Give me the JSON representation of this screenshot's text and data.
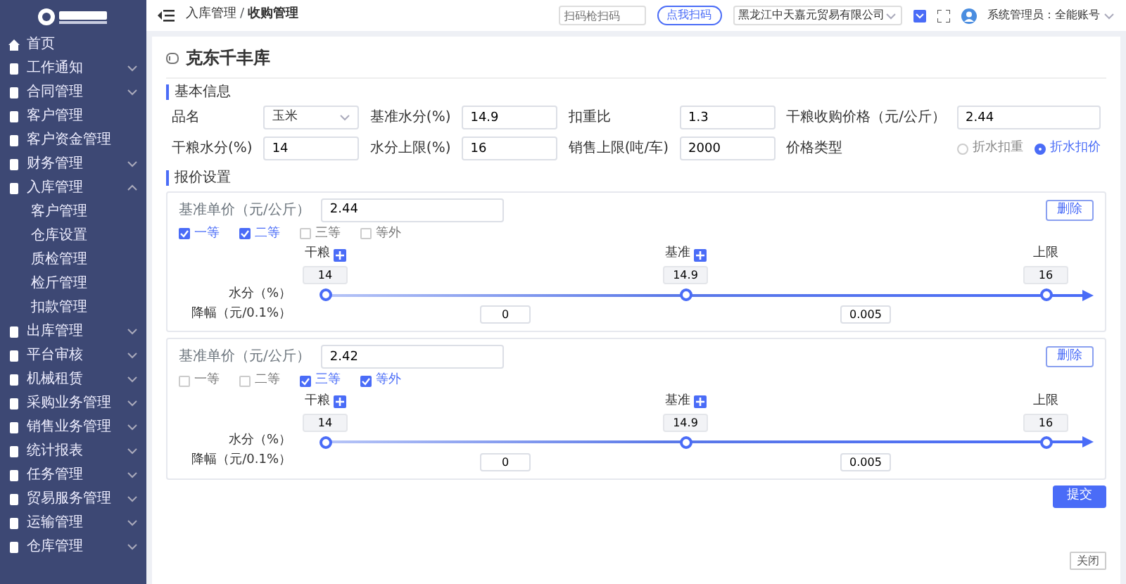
{
  "header": {
    "breadcrumb": [
      "入库管理",
      "收购管理"
    ],
    "breadcrumb_separator": "/",
    "search": {
      "placeholder": "扫码枪扫码"
    },
    "scan_button": "点我扫码",
    "company": "黑龙江中天嘉元贸易有限公司",
    "user": "系统管理员：全能账号"
  },
  "sidebar": {
    "items": [
      {
        "label": "首页",
        "kind": "link"
      },
      {
        "label": "工作通知",
        "kind": "group",
        "expanded": false
      },
      {
        "label": "合同管理",
        "kind": "group",
        "expanded": false
      },
      {
        "label": "客户管理",
        "kind": "link"
      },
      {
        "label": "客户资金管理",
        "kind": "link"
      },
      {
        "label": "财务管理",
        "kind": "group",
        "expanded": false
      },
      {
        "label": "入库管理",
        "kind": "group",
        "expanded": true,
        "children": [
          {
            "label": "客户管理"
          },
          {
            "label": "仓库设置"
          },
          {
            "label": "质检管理"
          },
          {
            "label": "检斤管理"
          },
          {
            "label": "扣款管理"
          }
        ]
      },
      {
        "label": "出库管理",
        "kind": "group",
        "expanded": false
      },
      {
        "label": "平台审核",
        "kind": "group",
        "expanded": false
      },
      {
        "label": "机械租赁",
        "kind": "group",
        "expanded": false
      },
      {
        "label": "采购业务管理",
        "kind": "group",
        "expanded": false
      },
      {
        "label": "销售业务管理",
        "kind": "group",
        "expanded": false
      },
      {
        "label": "统计报表",
        "kind": "group",
        "expanded": false
      },
      {
        "label": "任务管理",
        "kind": "group",
        "expanded": false
      },
      {
        "label": "贸易服务管理",
        "kind": "group",
        "expanded": false
      },
      {
        "label": "运输管理",
        "kind": "group",
        "expanded": false
      },
      {
        "label": "仓库管理",
        "kind": "group",
        "expanded": false
      }
    ]
  },
  "title": "克东千丰库",
  "basic_info": {
    "title": "基本信息",
    "fields": [
      {
        "label": "品名",
        "kind": "select",
        "value": "玉米"
      },
      {
        "label": "基准水分(%)",
        "kind": "text",
        "value": "14.9"
      },
      {
        "label": "扣重比",
        "kind": "text",
        "value": "1.3"
      },
      {
        "label": "干粮收购价格（元/公斤）",
        "kind": "text",
        "value": "2.44"
      },
      {
        "label": "干粮水分(%)",
        "kind": "text",
        "value": "14"
      },
      {
        "label": "水分上限(%)",
        "kind": "text",
        "value": "16"
      },
      {
        "label": "销售上限(吨/车)",
        "kind": "text",
        "value": "2000"
      },
      {
        "label": "价格类型",
        "kind": "radio",
        "options": [
          {
            "label": "折水扣重",
            "selected": false
          },
          {
            "label": "折水扣价",
            "selected": true
          }
        ]
      }
    ]
  },
  "price_settings": {
    "title": "报价设置",
    "blocks": [
      {
        "price_label": "基准单价（元/公斤）",
        "price": "2.44",
        "delete_button": "删除",
        "grades": [
          {
            "label": "一等",
            "checked": true
          },
          {
            "label": "二等",
            "checked": true
          },
          {
            "label": "三等",
            "checked": false
          },
          {
            "label": "等外",
            "checked": false
          }
        ],
        "nodes": [
          {
            "label": "干粮",
            "addable": true,
            "value": "14"
          },
          {
            "label": "基准",
            "addable": true,
            "value": "14.9"
          },
          {
            "label": "上限",
            "addable": false,
            "value": "16"
          }
        ],
        "axis_label": "水分（%）",
        "drop_label": "降幅（元/0.1%）",
        "drops": [
          "0",
          "0.005"
        ]
      },
      {
        "price_label": "基准单价（元/公斤）",
        "price": "2.42",
        "delete_button": "删除",
        "grades": [
          {
            "label": "一等",
            "checked": false
          },
          {
            "label": "二等",
            "checked": false
          },
          {
            "label": "三等",
            "checked": true
          },
          {
            "label": "等外",
            "checked": true
          }
        ],
        "nodes": [
          {
            "label": "干粮",
            "addable": true,
            "value": "14"
          },
          {
            "label": "基准",
            "addable": true,
            "value": "14.9"
          },
          {
            "label": "上限",
            "addable": false,
            "value": "16"
          }
        ],
        "axis_label": "水分（%）",
        "drop_label": "降幅（元/0.1%）",
        "drops": [
          "0",
          "0.005"
        ]
      }
    ],
    "submit_button": "提交"
  },
  "close_button": "关闭"
}
